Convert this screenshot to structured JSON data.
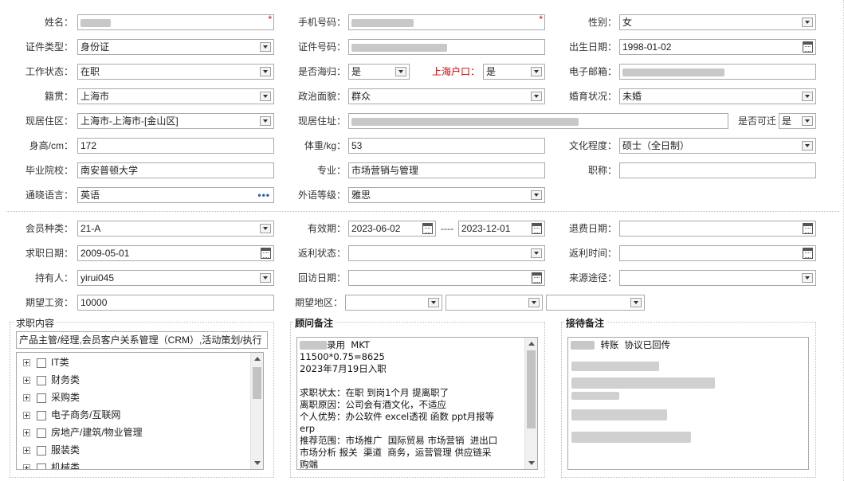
{
  "form": {
    "name_label": "姓名：",
    "phone_label": "手机号码：",
    "gender_label": "性别：",
    "gender_value": "女",
    "id_type_label": "证件类型：",
    "id_type_value": "身份证",
    "id_number_label": "证件号码：",
    "birth_label": "出生日期：",
    "birth_value": "1998-01-02",
    "work_status_label": "工作状态：",
    "work_status_value": "在职",
    "returnee_label": "是否海归：",
    "returnee_value": "是",
    "shanghai_hukou_label": "上海户口：",
    "shanghai_hukou_value": "是",
    "email_label": "电子邮箱：",
    "native_label": "籍贯：",
    "native_value": "上海市",
    "political_label": "政治面貌：",
    "political_value": "群众",
    "marital_label": "婚育状况：",
    "marital_value": "未婚",
    "residence_area_label": "现居住区：",
    "residence_area_value": "上海市-上海市-[金山区]",
    "address_label": "现居住址：",
    "relocate_label": "是否可迁",
    "relocate_value": "是",
    "height_label": "身高/cm：",
    "height_value": "172",
    "weight_label": "体重/kg：",
    "weight_value": "53",
    "education_label": "文化程度：",
    "education_value": "硕士（全日制）",
    "school_label": "毕业院校：",
    "school_value": "南安普顿大学",
    "major_label": "专业：",
    "major_value": "市场营销与管理",
    "title_label": "职称：",
    "language_label": "通晓语言：",
    "language_value": "英语",
    "language_more": "•••",
    "lang_level_label": "外语等级：",
    "lang_level_value": "雅思"
  },
  "member": {
    "type_label": "会员种类：",
    "type_value": "21-A",
    "valid_label": "有效期：",
    "valid_from": "2023-06-02",
    "valid_sep": "----",
    "valid_to": "2023-12-01",
    "refund_date_label": "退费日期：",
    "apply_date_label": "求职日期：",
    "apply_date_value": "2009-05-01",
    "rebate_status_label": "返利状态：",
    "rebate_time_label": "返利时间：",
    "holder_label": "持有人：",
    "holder_value": "yirui045",
    "visit_date_label": "回访日期：",
    "source_label": "来源途径：",
    "salary_label": "期望工资：",
    "salary_value": "10000",
    "region_label": "期望地区："
  },
  "job_panel": {
    "title": "求职内容",
    "selected": "产品主管/经理,会员客户关系管理（CRM）,活动策划/执行",
    "items": [
      "IT类",
      "财务类",
      "采购类",
      "电子商务/互联网",
      "房地产/建筑/物业管理",
      "服装类",
      "机械类"
    ]
  },
  "advisor_panel": {
    "title": "顾问备注",
    "line1_suffix": "录用  MKT",
    "lines": [
      "11500*0.75=8625",
      "2023年7月19日入职",
      "",
      "求职状太：在职 到岗1个月 提离职了",
      "离职原因：公司会有酒文化，不适应",
      "个人优势：办公软件 excel透视 函数 ppt月报等",
      "erp",
      "推荐范围：市场推广  国际贸易 市场营销  进出口",
      "市场分析 报关  渠道  商务，运营管理 供应链采",
      "购端"
    ]
  },
  "reception_panel": {
    "title": "接待备注",
    "line1": "转账  协议已回传"
  },
  "icons": [
    "dropdown-arrow-icon",
    "calendar-icon",
    "plus-expander-icon",
    "checkbox-icon",
    "scroll-up-icon",
    "scroll-down-icon"
  ],
  "colors": {
    "required": "#e00000",
    "hukou_label": "#d40000",
    "border": "#a9a9a9",
    "more_dots": "#2b5fb3"
  }
}
